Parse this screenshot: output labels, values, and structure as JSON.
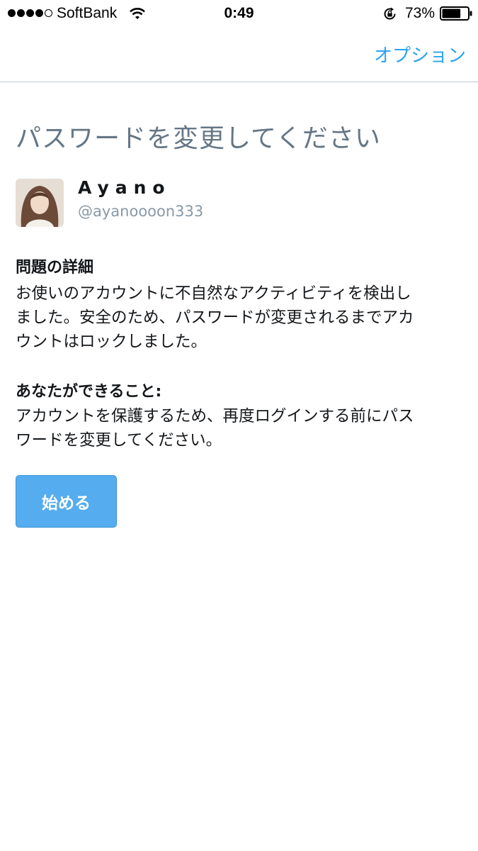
{
  "status_bar": {
    "carrier": "SoftBank",
    "time": "0:49",
    "battery": "73%",
    "signal_bars_filled": 4,
    "signal_bars_total": 5,
    "battery_level": 0.73
  },
  "nav": {
    "options_label": "オプション"
  },
  "page": {
    "title": "パスワードを変更してください"
  },
  "user": {
    "name": "Ayano",
    "handle": "@ayanoooon333"
  },
  "problem": {
    "heading": "問題の詳細",
    "lines": [
      "お使いのアカウントに不自然なアクティビティを検出し",
      "ました。安全のため、パスワードが変更されるまでアカ",
      "ウントはロックしました。"
    ]
  },
  "action": {
    "heading": "あなたができること:",
    "lines": [
      "アカウントを保護するため、再度ログインする前にパス",
      "ワードを変更してください。"
    ]
  },
  "start_button_label": "始める",
  "colors": {
    "accent": "#2aa3ef",
    "button": "#55acee",
    "muted": "#657786"
  }
}
